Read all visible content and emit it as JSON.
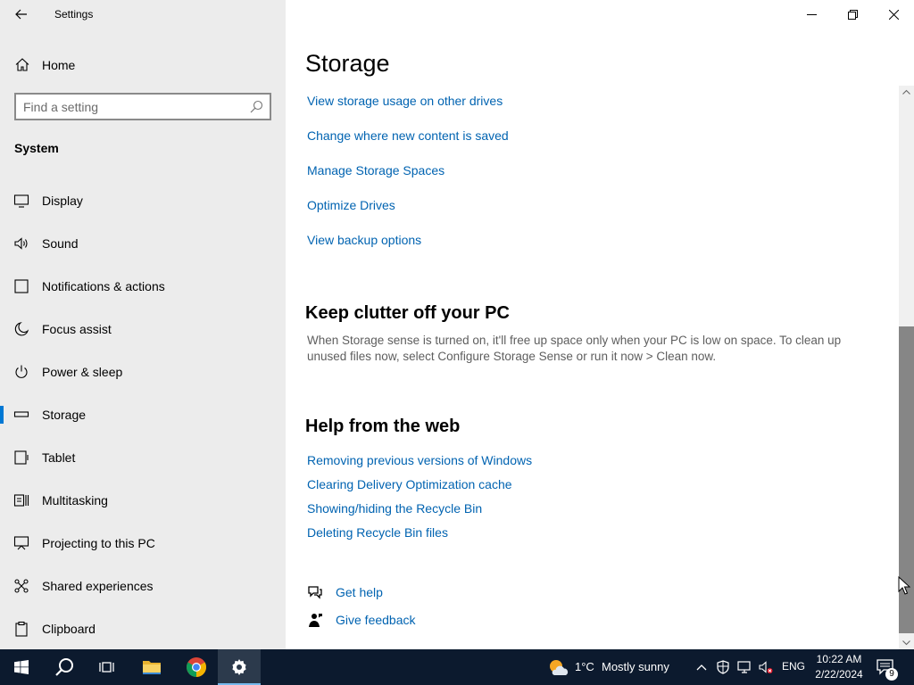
{
  "window": {
    "title": "Settings"
  },
  "sidebar": {
    "home_label": "Home",
    "search_placeholder": "Find a setting",
    "section_label": "System",
    "items": [
      {
        "label": "Display",
        "icon": "display-icon"
      },
      {
        "label": "Sound",
        "icon": "sound-icon"
      },
      {
        "label": "Notifications & actions",
        "icon": "notifications-icon"
      },
      {
        "label": "Focus assist",
        "icon": "moon-icon"
      },
      {
        "label": "Power & sleep",
        "icon": "power-icon"
      },
      {
        "label": "Storage",
        "icon": "storage-icon",
        "active": true
      },
      {
        "label": "Tablet",
        "icon": "tablet-icon"
      },
      {
        "label": "Multitasking",
        "icon": "multitasking-icon"
      },
      {
        "label": "Projecting to this PC",
        "icon": "projecting-icon"
      },
      {
        "label": "Shared experiences",
        "icon": "shared-experiences-icon"
      },
      {
        "label": "Clipboard",
        "icon": "clipboard-icon"
      }
    ]
  },
  "main": {
    "page_title": "Storage",
    "more_links": [
      "View storage usage on other drives",
      "Change where new content is saved",
      "Manage Storage Spaces",
      "Optimize Drives",
      "View backup options"
    ],
    "clutter": {
      "heading": "Keep clutter off your PC",
      "description": "When Storage sense is turned on, it'll free up space only when your PC is low on space. To clean up unused files now, select Configure Storage Sense or run it now > Clean now."
    },
    "help": {
      "heading": "Help from the web",
      "links": [
        "Removing previous versions of Windows",
        "Clearing Delivery Optimization cache",
        "Showing/hiding the Recycle Bin",
        "Deleting Recycle Bin files"
      ]
    },
    "get_help": "Get help",
    "give_feedback": "Give feedback"
  },
  "taskbar": {
    "weather_temp": "1°C",
    "weather_text": "Mostly sunny",
    "language": "ENG",
    "time": "10:22 AM",
    "date": "2/22/2024",
    "notification_count": "9"
  },
  "colors": {
    "accent": "#0078d4",
    "link": "#0063b1",
    "sidebar_bg": "#ececec",
    "taskbar_bg": "#0c1a2e"
  }
}
